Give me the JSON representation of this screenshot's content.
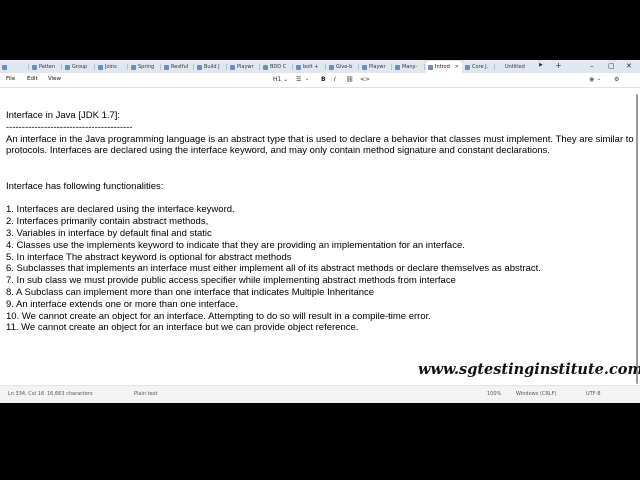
{
  "tabs": [
    {
      "label": "",
      "active": false
    },
    {
      "label": "Patten",
      "active": false
    },
    {
      "label": "Group",
      "active": false
    },
    {
      "label": "Joins",
      "active": false
    },
    {
      "label": "Spring",
      "active": false
    },
    {
      "label": "Restful",
      "active": false
    },
    {
      "label": "Build J",
      "active": false
    },
    {
      "label": "Playwr",
      "active": false
    },
    {
      "label": "BDD C",
      "active": false
    },
    {
      "label": "bolt +",
      "active": false
    },
    {
      "label": "Give-b",
      "active": false
    },
    {
      "label": "Playwr",
      "active": false
    },
    {
      "label": "Many-",
      "active": false
    },
    {
      "label": "Introd",
      "active": true
    },
    {
      "label": "Core J.",
      "active": false
    },
    {
      "label": "Untitled",
      "active": false
    }
  ],
  "menu": {
    "file": "File",
    "edit": "Edit",
    "view": "View"
  },
  "toolbar": {
    "heading": "H1",
    "bold": "B",
    "italic": "I",
    "link": "⛓",
    "code": "<>",
    "clear": "A̷"
  },
  "document": {
    "title": "Interface in Java [JDK 1.7]:",
    "divider": "----------------------------------------",
    "intro": "An interface in the Java programming language is an abstract type that is used to declare a behavior that classes must implement. They are similar to protocols. Interfaces are declared using the interface keyword, and may only contain method signature and constant declarations.",
    "subheading": "Interface has following functionalities:",
    "points": [
      "1. Interfaces are declared using the interface keyword.",
      "2. Interfaces primarily contain abstract methods,",
      "3. Variables in interface by default final and static",
      "4. Classes use the implements keyword to indicate that they are providing an implementation for an interface.",
      "5. In interface The abstract keyword is optional for abstract methods",
      "6. Subclasses that implements an interface must either implement all of its abstract methods or declare themselves as abstract.",
      "7. In sub class we must provide public access specifier while implementing abstract methods from interface",
      "8. A Subclass can implement more than one interface that indicates Multiple Inheritance",
      "9. An interface extends one or more than one interface.",
      "10. We cannot create an object for an interface. Attempting to do so will result in a compile-time error.",
      "11. We cannot create an object for an interface but we can provide object reference."
    ]
  },
  "watermark": "www.sgtestinginstitute.com",
  "status": {
    "position": "Ln 334, Col 16",
    "characters": "16,663 characters",
    "format": "Plain text",
    "zoom": "100%",
    "line_ending": "Windows (CRLF)",
    "encoding": "UTF-8"
  },
  "colors": {
    "tab_strip": "#dfe7f1",
    "tab_icon": "#6a8fbf",
    "letterbox": "#000000"
  }
}
